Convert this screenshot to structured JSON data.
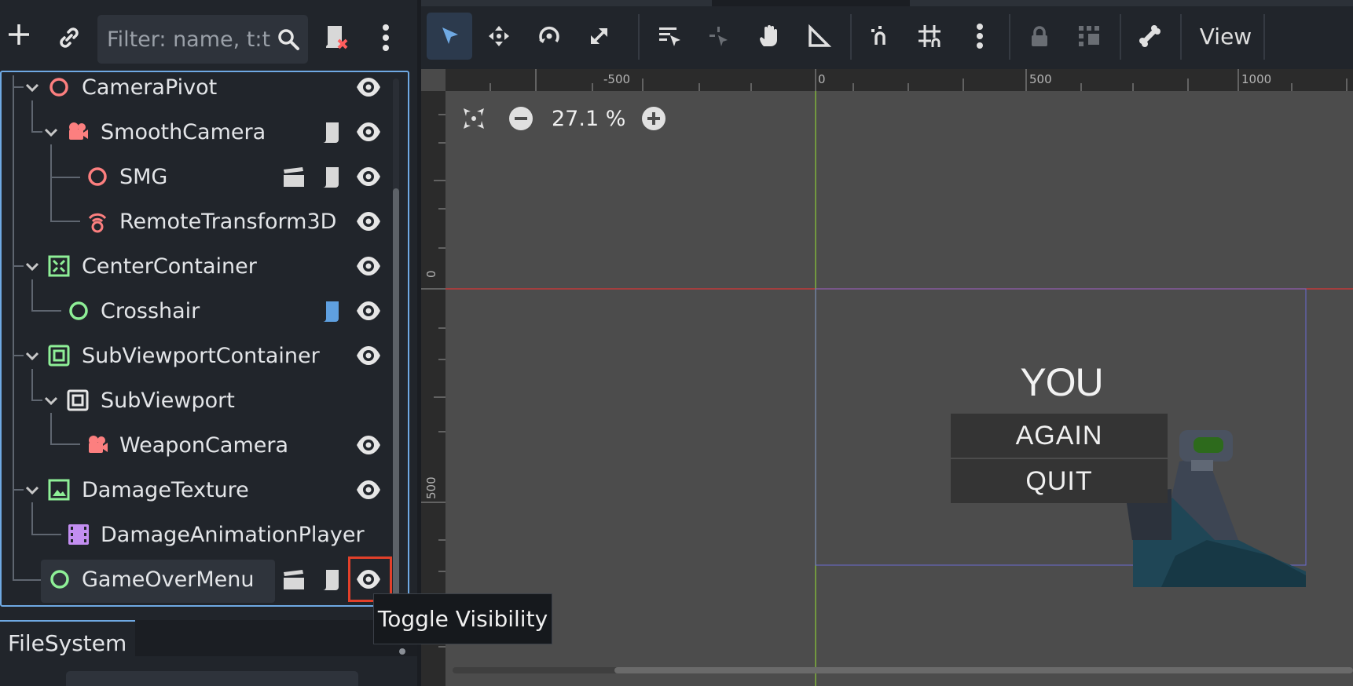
{
  "scene_toolbar": {
    "add_icon": "plus-icon",
    "link_icon": "link-icon",
    "filter_placeholder": "Filter: name, t:t",
    "search_icon": "search-icon",
    "clear_script_icon": "script-remove-icon",
    "more_icon": "kebab-icon"
  },
  "tree": {
    "nodes": [
      {
        "name": "CameraPivot",
        "icon": "node3d-icon"
      },
      {
        "name": "SmoothCamera",
        "icon": "camera3d-icon"
      },
      {
        "name": "SMG",
        "icon": "node3d-icon"
      },
      {
        "name": "RemoteTransform3D",
        "icon": "remote-transform-icon"
      },
      {
        "name": "CenterContainer",
        "icon": "center-container-icon"
      },
      {
        "name": "Crosshair",
        "icon": "control-icon"
      },
      {
        "name": "SubViewportContainer",
        "icon": "subviewport-container-icon"
      },
      {
        "name": "SubViewport",
        "icon": "subviewport-icon"
      },
      {
        "name": "WeaponCamera",
        "icon": "camera3d-icon"
      },
      {
        "name": "DamageTexture",
        "icon": "texture-rect-icon"
      },
      {
        "name": "DamageAnimationPlayer",
        "icon": "animation-player-icon"
      },
      {
        "name": "GameOverMenu",
        "icon": "control-icon"
      }
    ]
  },
  "tooltip": {
    "text": "Toggle Visibility"
  },
  "filesystem": {
    "tab_label": "FileSystem"
  },
  "viewport_toolbar": {
    "tools": [
      "select-icon",
      "move-icon",
      "rotate-icon",
      "scale-icon",
      "list-select-icon",
      "pivot-icon",
      "pan-icon",
      "ruler-icon",
      "smart-snap-icon",
      "grid-snap-icon",
      "kebab-icon",
      "lock-icon",
      "group-icon",
      "bone-icon"
    ],
    "view_label": "View"
  },
  "rulers": {
    "top": [
      "-500",
      "0",
      "500",
      "1000"
    ],
    "left": [
      "0",
      "500"
    ]
  },
  "zoom": {
    "value": "27.1 %"
  },
  "game_menu": {
    "title": "YOU DIED",
    "again_label": "AGAIN",
    "quit_label": "QUIT"
  },
  "colors": {
    "accent": "#6fa9e3",
    "node3d": "#fc7f7f",
    "control": "#8eef97",
    "highlight": "#e2402a",
    "script_blue": "#5fa0e0",
    "anim_purple": "#c38ef1"
  }
}
